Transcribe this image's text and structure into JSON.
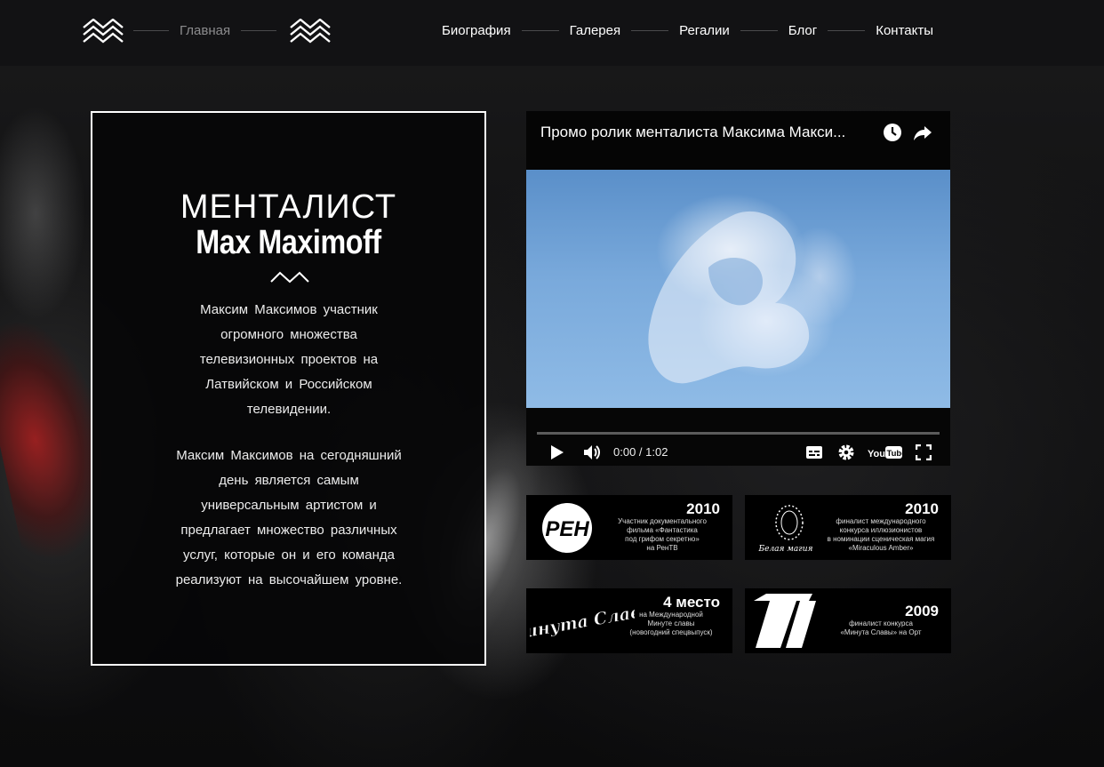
{
  "header": {
    "home_label": "Главная",
    "nav": [
      {
        "label": "Биография"
      },
      {
        "label": "Галерея"
      },
      {
        "label": "Регалии"
      },
      {
        "label": "Блог"
      },
      {
        "label": "Контакты"
      }
    ]
  },
  "intro": {
    "title": "МЕНТАЛИСТ",
    "name": "Max Maximoff",
    "paragraph1_lines": [
      "Максим Максимов участник",
      "огромного множества",
      "телевизионных проектов на",
      "Латвийском и Российском",
      "телевидении."
    ],
    "paragraph2_lines": [
      "Максим Максимов на сегодняшний",
      "день является самым",
      "универсальным артистом и",
      "предлагает множество различных",
      "услуг, которые он и его команда",
      "реализуют на высочайшем уровне."
    ]
  },
  "video": {
    "title": "Промо ролик менталиста Максима Макси...",
    "time": "0:00 / 1:02",
    "progress": 0,
    "youtube_label": "YouTube"
  },
  "awards": [
    {
      "logo_text": "РЕН",
      "year": "2010",
      "desc_lines": [
        "Участник документального",
        "фильма «Фантастика",
        "под грифом секретно»",
        "на РенТВ"
      ]
    },
    {
      "logo_text": "Белая магия",
      "year": "2010",
      "desc_lines": [
        "финалист международного",
        "конкурса иллюзионистов",
        "в номинации сценическая магия",
        "«Miraculous Amber»"
      ]
    },
    {
      "logo_text": "Минута Славы",
      "year": "4 место",
      "desc_lines": [
        "на Международной",
        "Минуте славы",
        "(новогодний спецвыпуск)"
      ]
    },
    {
      "logo_text": "1",
      "year": "2009",
      "desc_lines": [
        "финалист конкурса",
        "«Минута Славы» на Орт"
      ]
    }
  ],
  "colors": {
    "header_bg": "#121214",
    "card_border": "#ffffff",
    "nav_line": "#4a4a4c",
    "home_text": "#8c8c8e"
  }
}
